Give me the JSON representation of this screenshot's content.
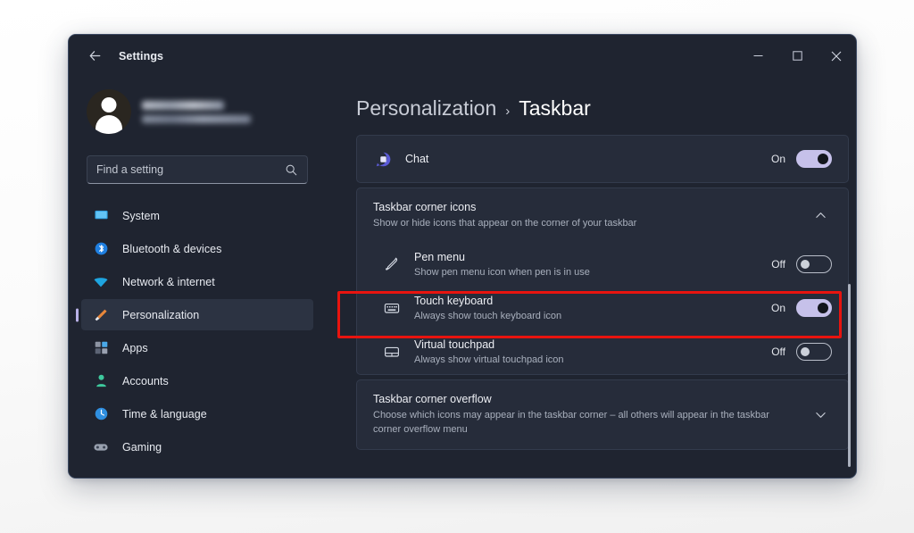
{
  "window": {
    "app_title": "Settings",
    "back_icon": "back-arrow-icon",
    "controls": {
      "minimize": "minimize-icon",
      "maximize": "maximize-icon",
      "close": "close-icon"
    }
  },
  "sidebar": {
    "profile": {
      "avatar_icon": "user-avatar-icon",
      "name": "",
      "email": ""
    },
    "search": {
      "placeholder": "Find a setting",
      "value": "",
      "icon": "search-icon"
    },
    "items": [
      {
        "label": "System",
        "icon": "system-monitor-icon",
        "selected": false
      },
      {
        "label": "Bluetooth & devices",
        "icon": "bluetooth-icon",
        "selected": false
      },
      {
        "label": "Network & internet",
        "icon": "wifi-icon",
        "selected": false
      },
      {
        "label": "Personalization",
        "icon": "paintbrush-icon",
        "selected": true
      },
      {
        "label": "Apps",
        "icon": "apps-grid-icon",
        "selected": false
      },
      {
        "label": "Accounts",
        "icon": "account-person-icon",
        "selected": false
      },
      {
        "label": "Time & language",
        "icon": "clock-icon",
        "selected": false
      },
      {
        "label": "Gaming",
        "icon": "gamepad-icon",
        "selected": false
      }
    ]
  },
  "main": {
    "breadcrumb": {
      "parent": "Personalization",
      "separator": "›",
      "current": "Taskbar"
    },
    "chat_row": {
      "title": "Chat",
      "icon": "chat-bubble-icon",
      "toggle_label": "On",
      "toggle_state": "on"
    },
    "corner_icons_section": {
      "title": "Taskbar corner icons",
      "subtitle": "Show or hide icons that appear on the corner of your taskbar",
      "chevron": "chevron-up-icon",
      "expanded": true,
      "rows": [
        {
          "title": "Pen menu",
          "subtitle": "Show pen menu icon when pen is in use",
          "icon": "pen-icon",
          "toggle_label": "Off",
          "toggle_state": "off"
        },
        {
          "title": "Touch keyboard",
          "subtitle": "Always show touch keyboard icon",
          "icon": "keyboard-icon",
          "toggle_label": "On",
          "toggle_state": "on"
        },
        {
          "title": "Virtual touchpad",
          "subtitle": "Always show virtual touchpad icon",
          "icon": "touchpad-icon",
          "toggle_label": "Off",
          "toggle_state": "off"
        }
      ]
    },
    "corner_overflow_section": {
      "title": "Taskbar corner overflow",
      "subtitle": "Choose which icons may appear in the taskbar corner – all others will appear in the taskbar corner overflow menu",
      "chevron": "chevron-down-icon",
      "expanded": false
    }
  },
  "annotation": {
    "color": "#e8140f",
    "target": "Touch keyboard"
  },
  "colors": {
    "window_bg": "#1f2430",
    "card_bg": "#262c3a",
    "accent": "#c6c1ea",
    "page_bg": "#ffffff",
    "selected_indicator": "#b9b2e8",
    "highlight": "#e8140f"
  }
}
